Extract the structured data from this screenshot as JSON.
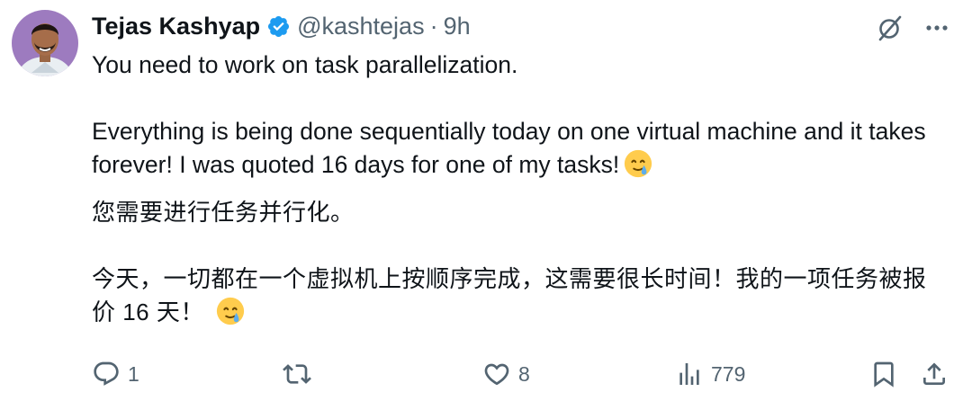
{
  "tweet": {
    "author": {
      "name": "Tejas Kashyap",
      "handle": "@kashtejas",
      "separator": "·",
      "time": "9h",
      "verified": true,
      "avatar_icon": "avatar-photo"
    },
    "lines": {
      "en_1": "You need to work on task parallelization.",
      "en_2": "Everything is being done sequentially today on one virtual machine and it takes forever! I was quoted 16 days for one of my tasks!",
      "zh_1": "您需要进行任务并行化。",
      "zh_2": "今天，一切都在一个虚拟机上按顺序完成，这需要很长时间！我的一项任务被报价 16 天！",
      "emoji_icon": "sad-smile-emoji"
    },
    "actions": {
      "replies": "1",
      "reposts": "",
      "likes": "8",
      "views": "779"
    }
  },
  "colors": {
    "text": "#0f1419",
    "muted": "#536471",
    "verified_blue": "#1d9bf0"
  }
}
